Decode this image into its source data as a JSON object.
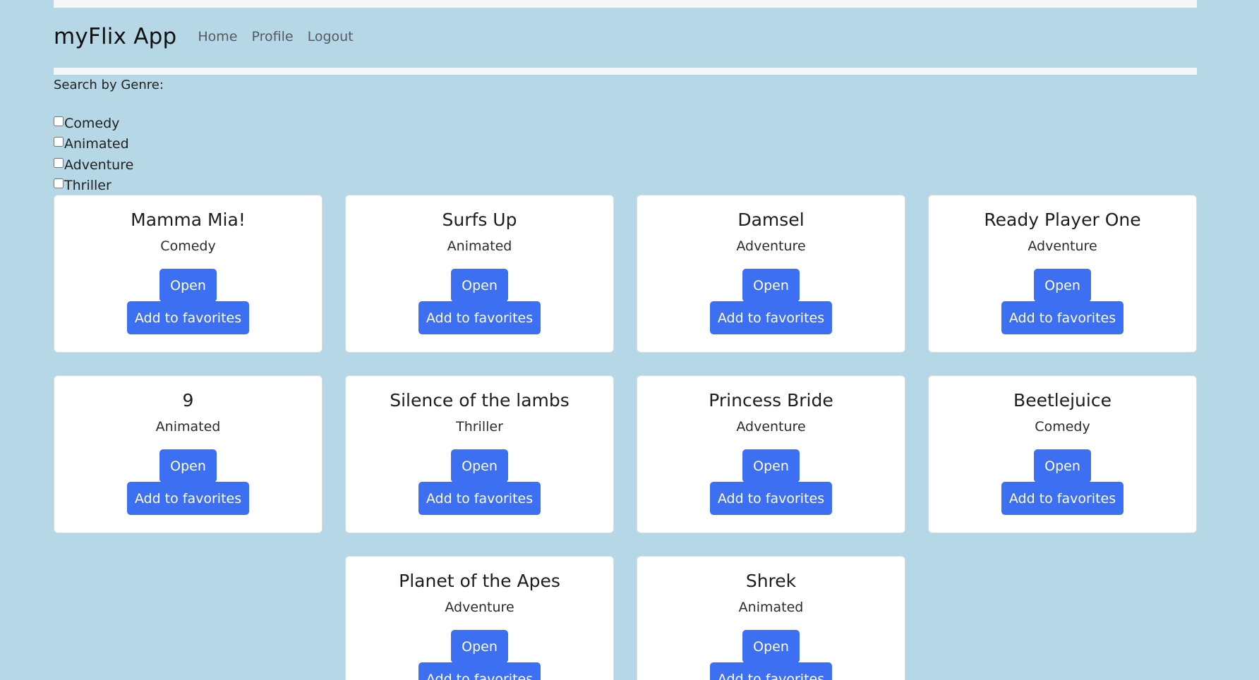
{
  "navbar": {
    "brand": "myFlix App",
    "links": [
      "Home",
      "Profile",
      "Logout"
    ]
  },
  "filter": {
    "title": "Search by Genre:",
    "genres": [
      {
        "label": "Comedy",
        "checked": false
      },
      {
        "label": "Animated",
        "checked": false
      },
      {
        "label": "Adventure",
        "checked": false
      },
      {
        "label": "Thriller",
        "checked": false
      }
    ]
  },
  "buttons": {
    "open_label": "Open",
    "favorite_label": "Add to favorites"
  },
  "movies": [
    {
      "title": "Mamma Mia!",
      "genre": "Comedy"
    },
    {
      "title": "Surfs Up",
      "genre": "Animated"
    },
    {
      "title": "Damsel",
      "genre": "Adventure"
    },
    {
      "title": "Ready Player One",
      "genre": "Adventure"
    },
    {
      "title": "9",
      "genre": "Animated"
    },
    {
      "title": "Silence of the lambs",
      "genre": "Thriller"
    },
    {
      "title": "Princess Bride",
      "genre": "Adventure"
    },
    {
      "title": "Beetlejuice",
      "genre": "Comedy"
    },
    {
      "title": "Planet of the Apes",
      "genre": "Adventure"
    },
    {
      "title": "Shrek",
      "genre": "Animated"
    }
  ]
}
